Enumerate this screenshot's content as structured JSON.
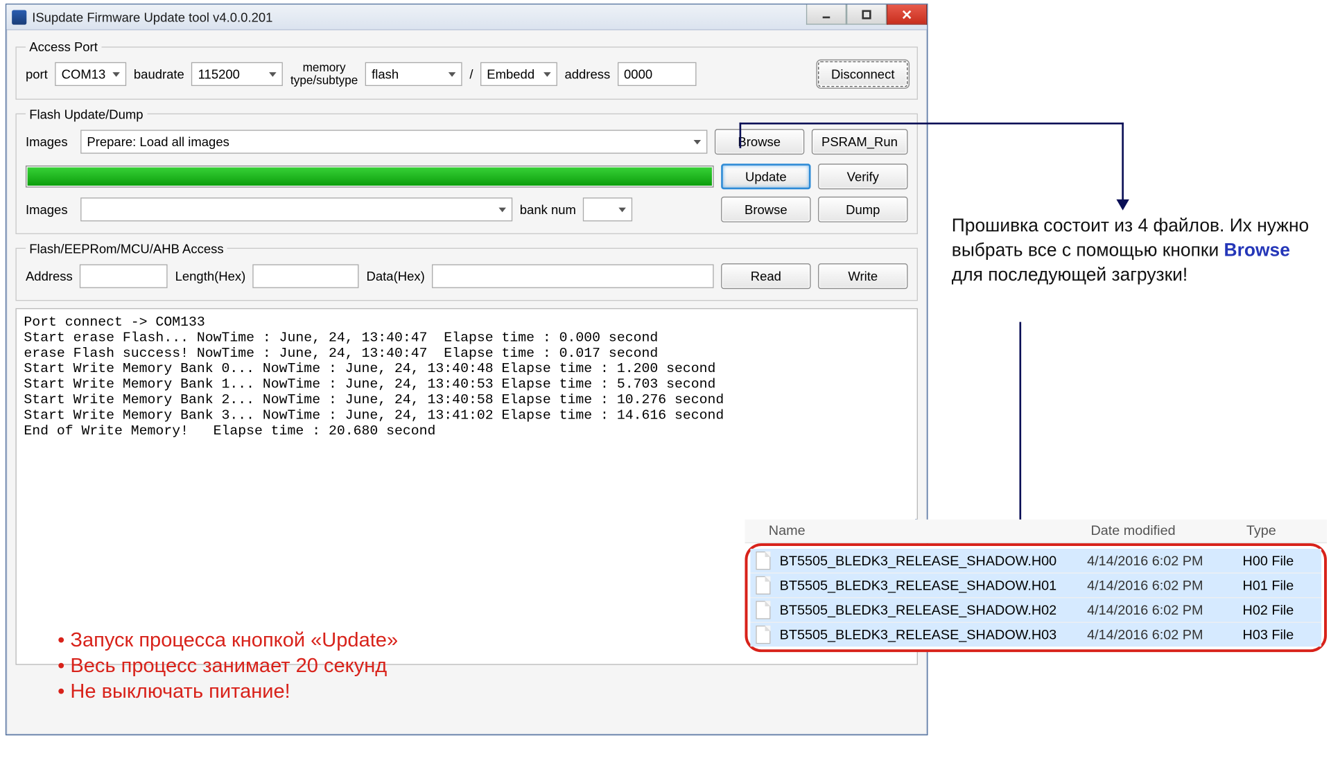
{
  "window": {
    "title": "ISupdate Firmware Update tool  v4.0.0.201"
  },
  "access": {
    "legend": "Access Port",
    "port_label": "port",
    "port_value": "COM13",
    "baud_label": "baudrate",
    "baud_value": "115200",
    "mem_label_top": "memory",
    "mem_label_bottom": "type/subtype",
    "mem_value": "flash",
    "subtype_value": "Embedd",
    "addr_label": "address",
    "addr_value": "0000",
    "disconnect": "Disconnect"
  },
  "flash": {
    "legend": "Flash Update/Dump",
    "images_label": "Images",
    "images_value": "Prepare: Load all images",
    "images2_label": "Images",
    "banknum_label": "bank num",
    "browse": "Browse",
    "psram": "PSRAM_Run",
    "update": "Update",
    "verify": "Verify",
    "dump": "Dump"
  },
  "mem": {
    "legend": "Flash/EEPRom/MCU/AHB Access",
    "addr_label": "Address",
    "len_label": "Length(Hex)",
    "data_label": "Data(Hex)",
    "read": "Read",
    "write": "Write"
  },
  "log_lines": [
    "Port connect -> COM133",
    "Start erase Flash... NowTime : June, 24, 13:40:47  Elapse time : 0.000 second",
    "erase Flash success! NowTime : June, 24, 13:40:47  Elapse time : 0.017 second",
    "Start Write Memory Bank 0... NowTime : June, 24, 13:40:48 Elapse time : 1.200 second",
    "Start Write Memory Bank 1... NowTime : June, 24, 13:40:53 Elapse time : 5.703 second",
    "Start Write Memory Bank 2... NowTime : June, 24, 13:40:58 Elapse time : 10.276 second",
    "Start Write Memory Bank 3... NowTime : June, 24, 13:41:02 Elapse time : 14.616 second",
    "End of Write Memory!   Elapse time : 20.680 second"
  ],
  "notes": {
    "line1": "Запуск процесса кнопкой «Update»",
    "line2": "Весь процесс занимает 20 секунд",
    "line3": "Не выключать питание!"
  },
  "side": {
    "part1": "Прошивка состоит из 4 файлов. Их нужно выбрать все с помощью кнопки ",
    "keyword": "Browse",
    "part2": " для последующей загрузки!"
  },
  "filelist": {
    "col_name": "Name",
    "col_date": "Date modified",
    "col_type": "Type",
    "rows": [
      {
        "name": "BT5505_BLEDK3_RELEASE_SHADOW.H00",
        "date": "4/14/2016 6:02 PM",
        "type": "H00 File"
      },
      {
        "name": "BT5505_BLEDK3_RELEASE_SHADOW.H01",
        "date": "4/14/2016 6:02 PM",
        "type": "H01 File"
      },
      {
        "name": "BT5505_BLEDK3_RELEASE_SHADOW.H02",
        "date": "4/14/2016 6:02 PM",
        "type": "H02 File"
      },
      {
        "name": "BT5505_BLEDK3_RELEASE_SHADOW.H03",
        "date": "4/14/2016 6:02 PM",
        "type": "H03 File"
      }
    ]
  }
}
